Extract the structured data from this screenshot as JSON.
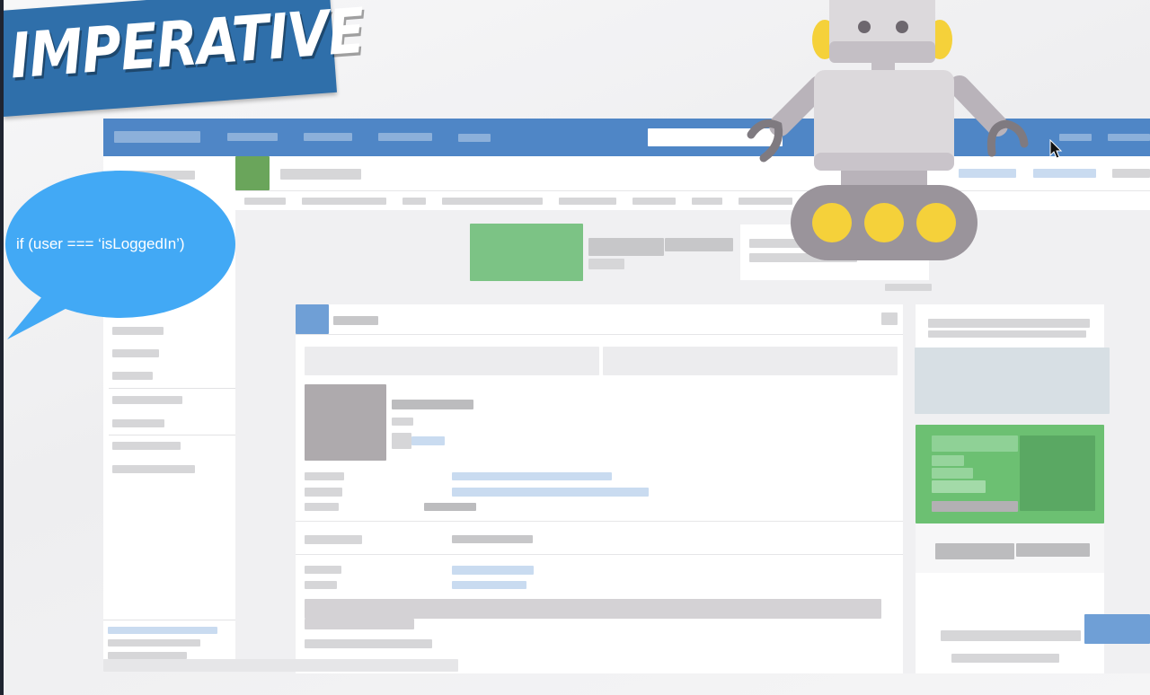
{
  "banner": {
    "title": "IMPERATIVE",
    "color": "#2f6faa"
  },
  "speech_bubble": {
    "text": "if (user === ‘isLoggedIn’)",
    "color": "#42a9f5"
  },
  "mockup": {
    "nav_color": "#4f86c6",
    "profile_color": "#7cc385",
    "avatar_color": "#aeaaad",
    "ad_color": "#6cc072"
  },
  "robot": {
    "body_color": "#dcd9dc",
    "accent_color": "#f5d13a"
  },
  "icons": [
    "cursor-icon",
    "robot-illustration"
  ]
}
